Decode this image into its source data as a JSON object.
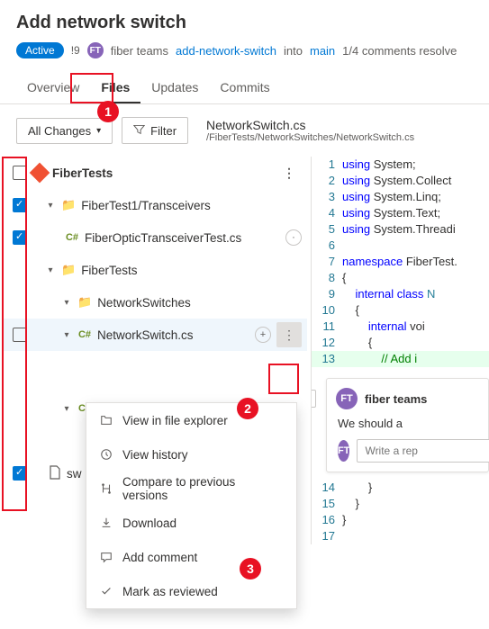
{
  "header": {
    "title": "Add network switch",
    "status_badge": "Active",
    "id": "!9",
    "avatar_initials": "FT",
    "author": "fiber teams",
    "source_branch": "add-network-switch",
    "into": "into",
    "target_branch": "main",
    "comments_status": "1/4 comments resolve"
  },
  "tabs": {
    "overview": "Overview",
    "files": "Files",
    "updates": "Updates",
    "commits": "Commits"
  },
  "toolbar": {
    "all_changes": "All Changes",
    "filter": "Filter",
    "path_title": "NetworkSwitch.cs",
    "path_sub": "/FiberTests/NetworkSwitches/NetworkSwitch.cs"
  },
  "tree": {
    "root": "FiberTests",
    "folder1": "FiberTest1/Transceivers",
    "file1": "FiberOpticTransceiverTest.cs",
    "folder2": "FiberTests",
    "folder3": "NetworkSwitches",
    "file2": "NetworkSwitch.cs",
    "file3_prefix": "C#",
    "file4": "sw",
    "pill_dot": "·",
    "pill_plus": "+"
  },
  "context_menu": {
    "view_explorer": "View in file explorer",
    "view_history": "View history",
    "compare": "Compare to previous versions",
    "download": "Download",
    "add_comment": "Add comment",
    "mark_reviewed": "Mark as reviewed"
  },
  "code": {
    "l1": "using System;",
    "l2": "using System.Collect",
    "l3": "using System.Linq;",
    "l4": "using System.Text;",
    "l5": "using System.Threadi",
    "l7": "namespace FiberTest.",
    "l8": "{",
    "l9": "    internal class N",
    "l10": "    {",
    "l11": "        internal voi",
    "l12": "        {",
    "l13": "            // Add i",
    "l14": "        }",
    "l15": "    }",
    "l16": "}"
  },
  "comment": {
    "author": "fiber teams",
    "body": "We should a",
    "reply_placeholder": "Write a rep"
  },
  "annotations": {
    "n1": "1",
    "n2": "2",
    "n3": "3"
  }
}
